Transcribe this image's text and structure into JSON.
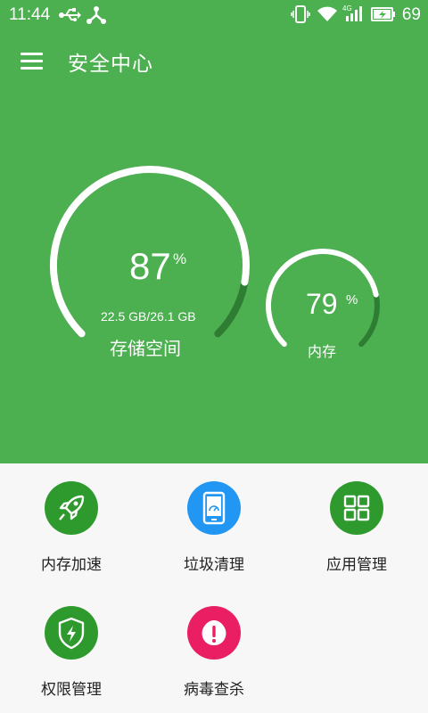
{
  "status_bar": {
    "time": "11:44",
    "battery": "69",
    "icons": [
      "usb-icon",
      "share-icon",
      "vibrate-icon",
      "wifi-icon",
      "4g-signal-icon",
      "battery-charging-icon"
    ]
  },
  "app_bar": {
    "title": "安全中心",
    "menu_icon": "hamburger-menu-icon"
  },
  "storage": {
    "percent": "87",
    "percent_sign": "%",
    "usage": "22.5 GB/26.1 GB",
    "label": "存储空间",
    "fill_fraction": 0.87
  },
  "memory": {
    "percent": "79",
    "percent_sign": "%",
    "label": "内存",
    "fill_fraction": 0.79
  },
  "tools": [
    {
      "label": "内存加速",
      "icon": "rocket-icon",
      "color": "#2e9a2e"
    },
    {
      "label": "垃圾清理",
      "icon": "phone-clean-icon",
      "color": "#2196f3"
    },
    {
      "label": "应用管理",
      "icon": "apps-grid-icon",
      "color": "#2e9a2e"
    },
    {
      "label": "权限管理",
      "icon": "shield-bolt-icon",
      "color": "#2e9a2e"
    },
    {
      "label": "病毒查杀",
      "icon": "virus-alert-icon",
      "color": "#e91e63"
    }
  ],
  "colors": {
    "primary": "#4caf50",
    "arc_track": "#2e7d32",
    "arc_fill": "#ffffff"
  }
}
